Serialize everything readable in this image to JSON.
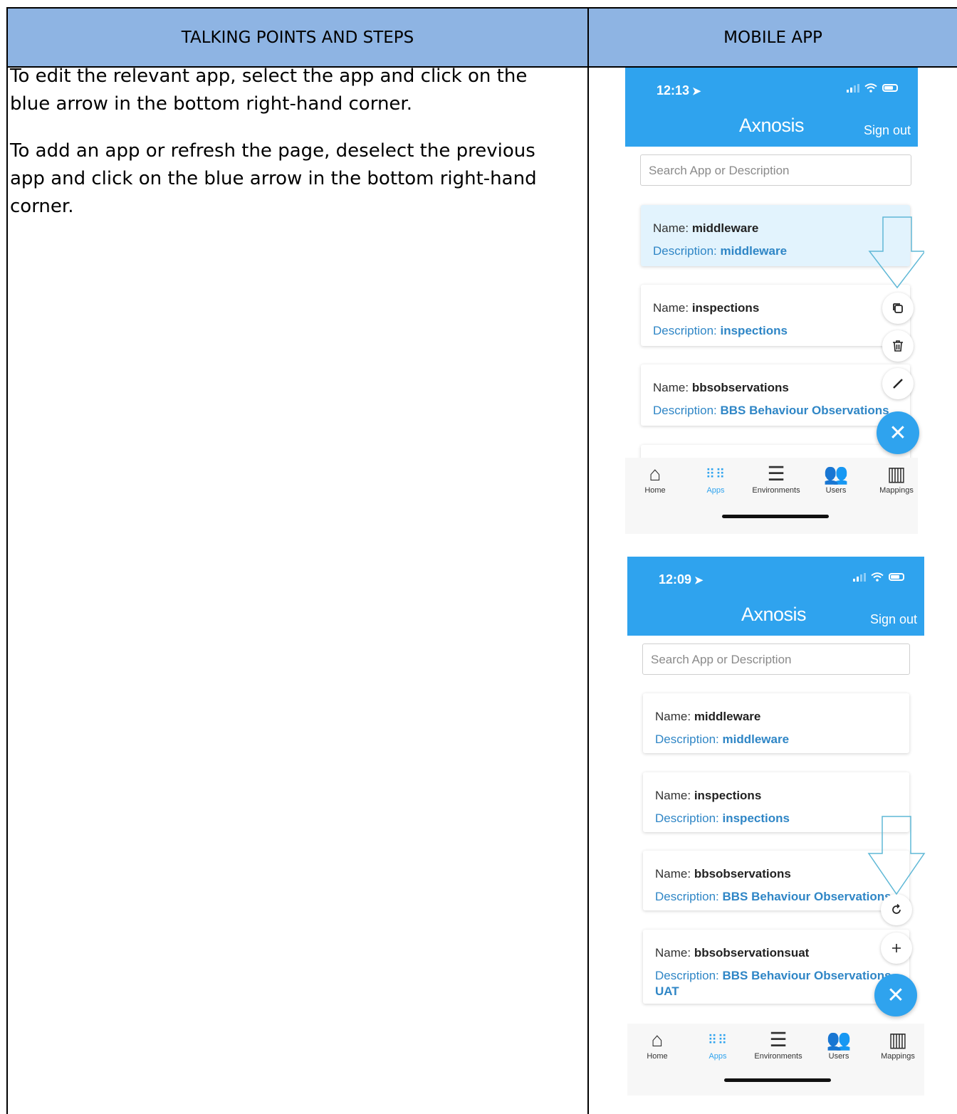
{
  "table": {
    "left_header": "TALKING POINTS AND STEPS",
    "right_header": "MOBILE APP"
  },
  "steps": {
    "p1": "To edit the relevant app, select the app and click on the blue arrow in the bottom right-hand corner.",
    "p2": "To add an app or refresh the page, deselect the previous app and click on the blue arrow in the bottom right-hand corner."
  },
  "phone1": {
    "time": "12:13",
    "brand": "Axnosis",
    "sign_out": "Sign out",
    "search_placeholder": "Search App or Description",
    "name_label": "Name:",
    "desc_label": "Description:",
    "cards": [
      {
        "name": "middleware",
        "description": "middleware",
        "selected": true
      },
      {
        "name": "inspections",
        "description": "inspections"
      },
      {
        "name": "bbsobservations",
        "description": "BBS Behaviour Observations"
      }
    ],
    "actions": [
      "copy-icon",
      "trash-icon",
      "pencil-icon"
    ],
    "fab_icon": "close-icon"
  },
  "phone2": {
    "time": "12:09",
    "brand": "Axnosis",
    "sign_out": "Sign out",
    "search_placeholder": "Search App or Description",
    "name_label": "Name:",
    "desc_label": "Description:",
    "cards": [
      {
        "name": "middleware",
        "description": "middleware"
      },
      {
        "name": "inspections",
        "description": "inspections"
      },
      {
        "name": "bbsobservations",
        "description": "BBS Behaviour Observations"
      },
      {
        "name": "bbsobservationsuat",
        "description": "BBS Behaviour Observations UAT"
      }
    ],
    "actions": [
      "refresh-icon",
      "plus-icon"
    ],
    "fab_icon": "close-icon"
  },
  "tabs": [
    {
      "label": "Home",
      "icon": "home-icon"
    },
    {
      "label": "Apps",
      "icon": "apps-grid-icon",
      "active": true
    },
    {
      "label": "Environments",
      "icon": "database-icon"
    },
    {
      "label": "Users",
      "icon": "users-icon"
    },
    {
      "label": "Mappings",
      "icon": "map-icon"
    }
  ],
  "colors": {
    "header_fill": "#8eb4e3",
    "app_blue": "#2fa3ee",
    "annotation_arrow": "#5fb8d6"
  }
}
